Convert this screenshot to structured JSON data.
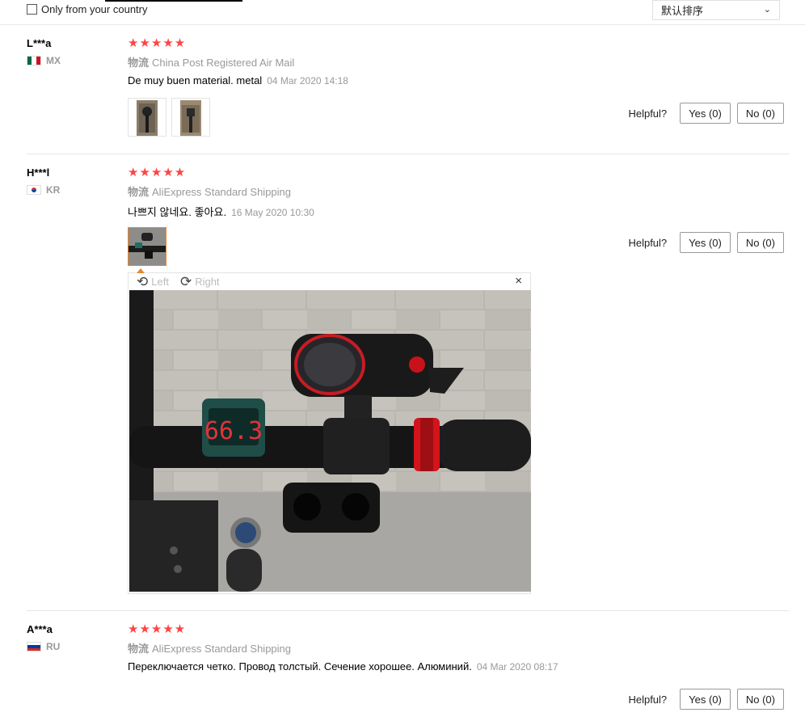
{
  "filter": {
    "only_country_label": "Only from your country",
    "sort_selected": "默认排序"
  },
  "reviews": [
    {
      "user": "L***a",
      "country": "MX",
      "stars": "★★★★★",
      "shipping_prefix": "物流",
      "shipping": "China Post Registered Air Mail",
      "text": "De muy buen material. metal",
      "date": "04 Mar 2020 14:18",
      "helpful_label": "Helpful?",
      "yes": "Yes (0)",
      "no": "No (0)"
    },
    {
      "user": "H***l",
      "country": "KR",
      "stars": "★★★★★",
      "shipping_prefix": "物流",
      "shipping": "AliExpress Standard Shipping",
      "text": "나쁘지 않네요. 좋아요.",
      "date": "16 May 2020 10:30",
      "helpful_label": "Helpful?",
      "yes": "Yes (0)",
      "no": "No (0)"
    },
    {
      "user": "A***a",
      "country": "RU",
      "stars": "★★★★★",
      "shipping_prefix": "物流",
      "shipping": "AliExpress Standard Shipping",
      "text": "Переключается четко. Провод толстый. Сечение хорошее. Алюминий.",
      "date": "04 Mar 2020 08:17",
      "helpful_label": "Helpful?",
      "yes": "Yes (0)",
      "no": "No (0)"
    }
  ],
  "viewer": {
    "rotate_left": "Left",
    "rotate_right": "Right",
    "close": "×",
    "display_reading": "66.3"
  }
}
